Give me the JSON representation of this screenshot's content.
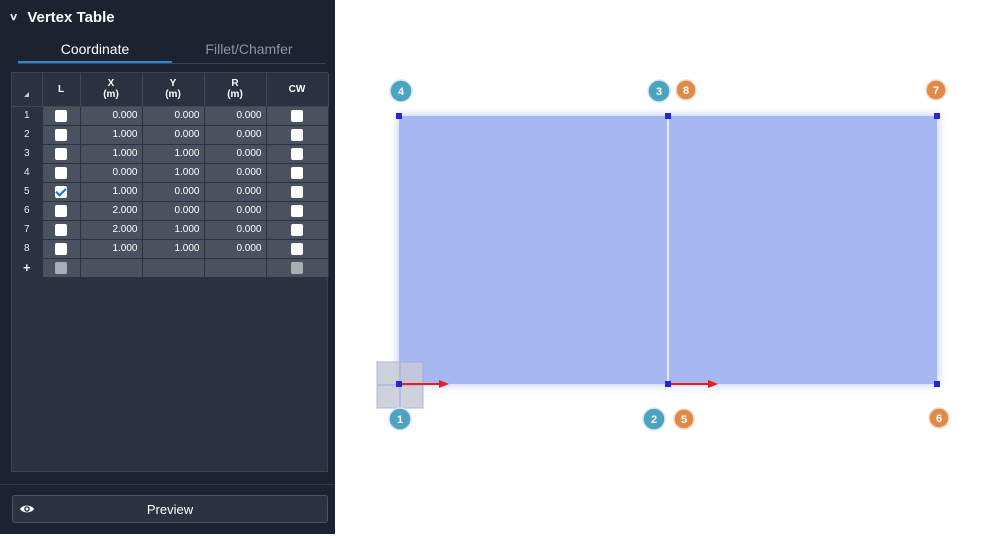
{
  "panel": {
    "title": "Vertex Table",
    "tabs": [
      {
        "label": "Coordinate",
        "active": true
      },
      {
        "label": "Fillet/Chamfer",
        "active": false
      }
    ]
  },
  "table": {
    "headers": {
      "l": "L",
      "x": "X",
      "x_unit": "(m)",
      "y": "Y",
      "y_unit": "(m)",
      "r": "R",
      "r_unit": "(m)",
      "cw": "CW"
    },
    "rows": [
      {
        "index": "1",
        "l": false,
        "x": "0.000",
        "y": "0.000",
        "r": "0.000",
        "cw": false
      },
      {
        "index": "2",
        "l": false,
        "x": "1.000",
        "y": "0.000",
        "r": "0.000",
        "cw": false
      },
      {
        "index": "3",
        "l": false,
        "x": "1.000",
        "y": "1.000",
        "r": "0.000",
        "cw": false
      },
      {
        "index": "4",
        "l": false,
        "x": "0.000",
        "y": "1.000",
        "r": "0.000",
        "cw": false
      },
      {
        "index": "5",
        "l": true,
        "x": "1.000",
        "y": "0.000",
        "r": "0.000",
        "cw": false
      },
      {
        "index": "6",
        "l": false,
        "x": "2.000",
        "y": "0.000",
        "r": "0.000",
        "cw": false
      },
      {
        "index": "7",
        "l": false,
        "x": "2.000",
        "y": "1.000",
        "r": "0.000",
        "cw": false
      },
      {
        "index": "8",
        "l": false,
        "x": "1.000",
        "y": "1.000",
        "r": "0.000",
        "cw": false
      }
    ],
    "add_row_label": "+"
  },
  "preview": {
    "label": "Preview"
  },
  "canvas": {
    "labels_teal": [
      "1",
      "2",
      "3",
      "4"
    ],
    "labels_orange": [
      "5",
      "6",
      "7",
      "8"
    ]
  },
  "colors": {
    "panel_bg": "#1c2230",
    "accent_tab": "#2f86d4",
    "fill": "#a7b7f2",
    "vertex": "#2626d9",
    "teal_badge": "#4aa3c0",
    "orange_badge": "#e08a47",
    "axis_arrow": "#e81d1d"
  }
}
